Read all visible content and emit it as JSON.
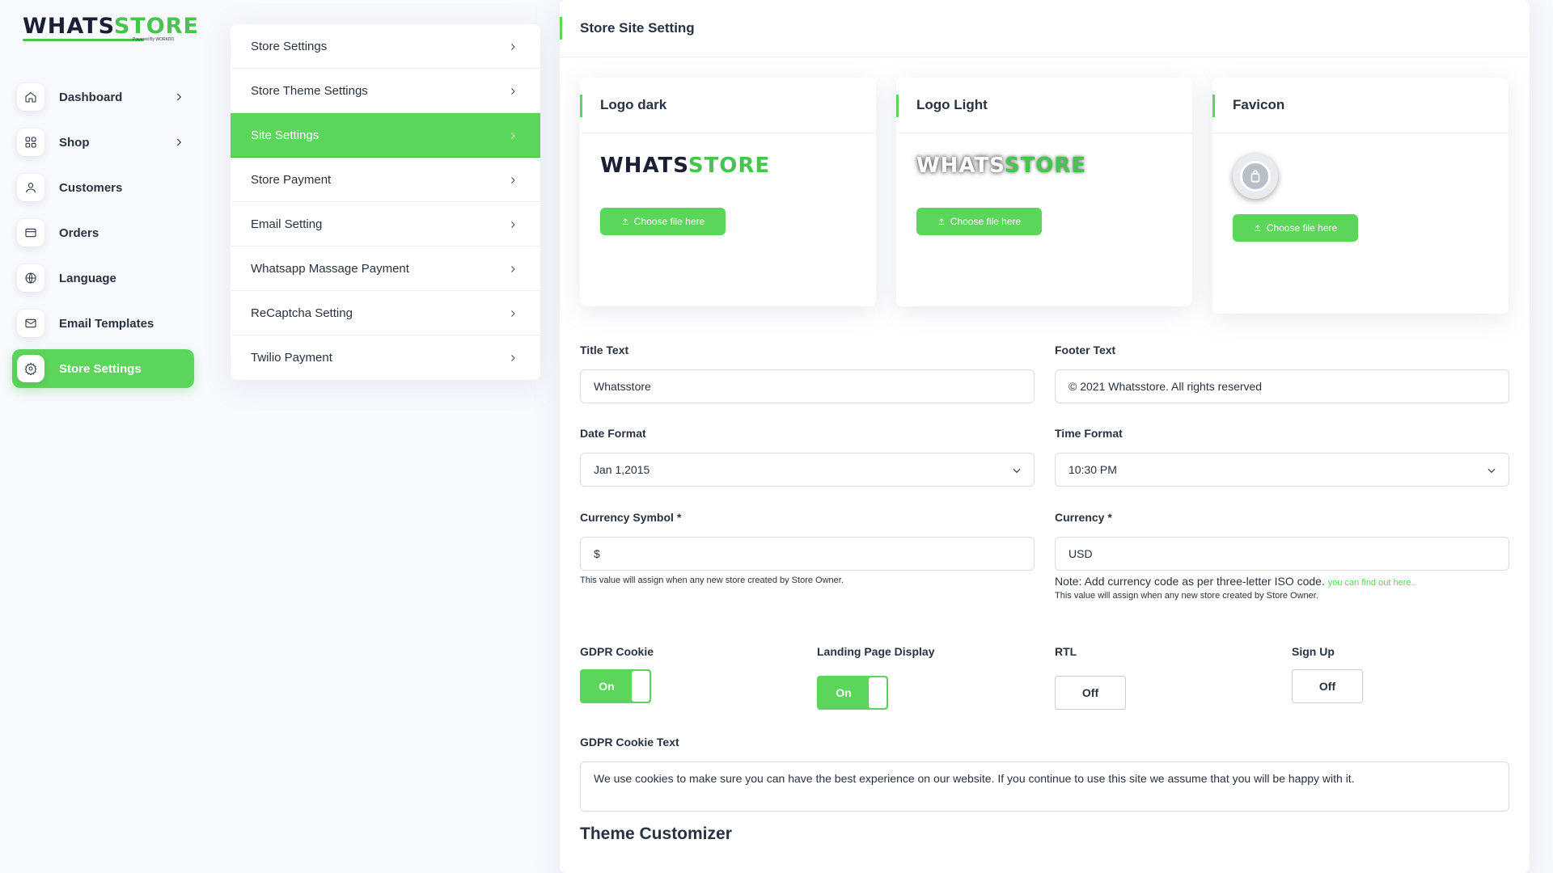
{
  "brand": {
    "part1": "WHATS",
    "part2": "STORE",
    "tagline": "Powered By WORKDO"
  },
  "sidebar": {
    "items": [
      {
        "label": "Dashboard",
        "icon": "home-icon",
        "has_children": true
      },
      {
        "label": "Shop",
        "icon": "grid-icon",
        "has_children": true
      },
      {
        "label": "Customers",
        "icon": "user-icon",
        "has_children": false
      },
      {
        "label": "Orders",
        "icon": "card-icon",
        "has_children": false
      },
      {
        "label": "Language",
        "icon": "globe-icon",
        "has_children": false
      },
      {
        "label": "Email Templates",
        "icon": "mail-icon",
        "has_children": false
      },
      {
        "label": "Store Settings",
        "icon": "gear-icon",
        "has_children": false,
        "active": true
      }
    ]
  },
  "submenu": {
    "items": [
      {
        "label": "Store Settings"
      },
      {
        "label": "Store Theme Settings"
      },
      {
        "label": "Site Settings",
        "active": true
      },
      {
        "label": "Store Payment"
      },
      {
        "label": "Email Setting"
      },
      {
        "label": "Whatsapp Massage Payment"
      },
      {
        "label": "ReCaptcha Setting"
      },
      {
        "label": "Twilio Payment"
      }
    ]
  },
  "main": {
    "title": "Store Site Setting",
    "logo_cards": [
      {
        "title": "Logo dark",
        "button": "Choose file here"
      },
      {
        "title": "Logo Light",
        "button": "Choose file here"
      },
      {
        "title": "Favicon",
        "button": "Choose file here"
      }
    ],
    "fields": {
      "title_text": {
        "label": "Title Text",
        "value": "Whatsstore"
      },
      "footer_text": {
        "label": "Footer Text",
        "value": "© 2021 Whatsstore. All rights reserved"
      },
      "date_format": {
        "label": "Date Format",
        "value": "Jan 1,2015"
      },
      "time_format": {
        "label": "Time Format",
        "value": "10:30 PM"
      },
      "currency_symbol": {
        "label": "Currency Symbol *",
        "value": "$",
        "help": "This value will assign when any new store created by Store Owner."
      },
      "currency": {
        "label": "Currency *",
        "value": "USD",
        "note": "Note: Add currency code as per three-letter ISO code.",
        "link": "you can find out here..",
        "help": "This value will assign when any new store created by Store Owner."
      }
    },
    "toggles": [
      {
        "label": "GDPR Cookie",
        "state": "On",
        "on": true
      },
      {
        "label": "Landing Page Display",
        "state": "On",
        "on": true
      },
      {
        "label": "RTL",
        "state": "Off",
        "on": false
      },
      {
        "label": "Sign Up",
        "state": "Off",
        "on": false
      }
    ],
    "gdpr_text": {
      "label": "GDPR Cookie Text",
      "value": "We use cookies to make sure you can have the best experience on our website. If you continue to use this site we assume that you will be happy with it."
    },
    "theme_customizer": "Theme Customizer"
  },
  "colors": {
    "accent": "#5bd55a",
    "text": "#293240",
    "border": "#d8dce3"
  }
}
